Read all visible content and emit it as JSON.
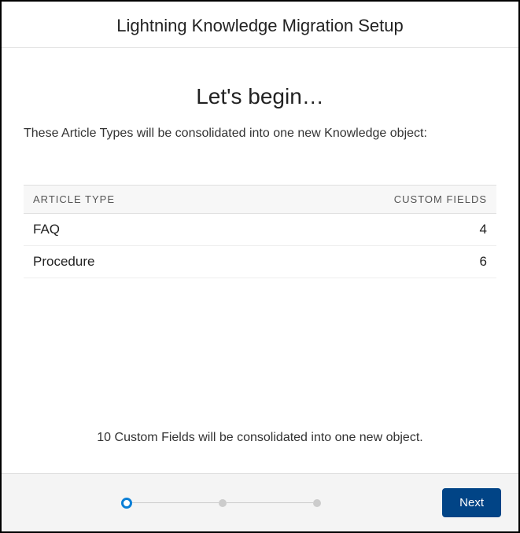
{
  "header": {
    "title": "Lightning Knowledge Migration Setup"
  },
  "main": {
    "subtitle": "Let's begin…",
    "description": "These Article Types will be consolidated into one new Knowledge object:",
    "table": {
      "headers": {
        "name": "ARTICLE TYPE",
        "count": "CUSTOM FIELDS"
      },
      "rows": [
        {
          "name": "FAQ",
          "count": "4"
        },
        {
          "name": "Procedure",
          "count": "6"
        }
      ]
    },
    "summary": "10 Custom Fields will be consolidated into one new object."
  },
  "footer": {
    "next_label": "Next"
  }
}
